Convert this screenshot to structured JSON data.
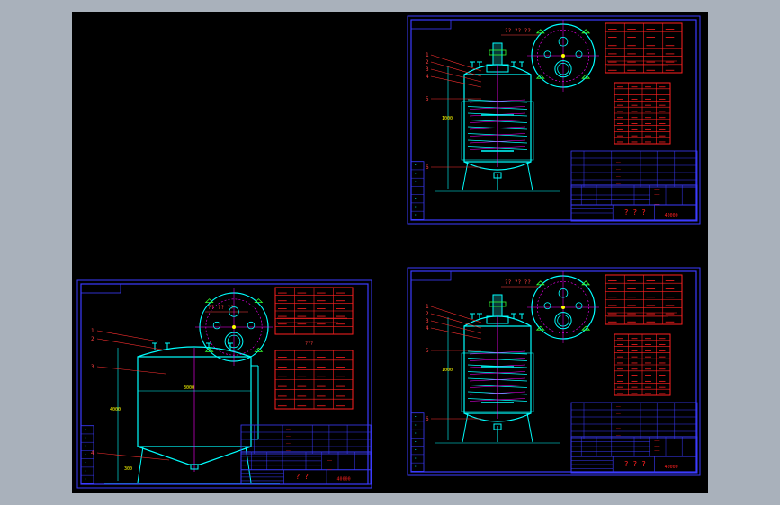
{
  "app": {
    "background_color": "#a9b1bb",
    "canvas_color": "#000000"
  },
  "colors": {
    "frame": "#3b3bff",
    "vessel": "#00ffff",
    "leader": "#ff3030",
    "table": "#ff2020",
    "callout": "#ff4040",
    "hatch": "#ff00ff",
    "green": "#33ff33",
    "yellow": "#ffff00"
  },
  "drawings": [
    {
      "id": "top-right",
      "type": "agitated-reactor",
      "section_title": "?? ?? ??",
      "title_block_name": "? ? ?",
      "drawing_number": "40000",
      "callouts": [
        "1",
        "2",
        "3",
        "4",
        "5",
        "6"
      ]
    },
    {
      "id": "bottom-left",
      "type": "storage-tank",
      "section_title": "?? ?? ??",
      "title_block_name": "? ?",
      "drawing_number": "40000",
      "callouts": [
        "1",
        "2",
        "3",
        "4"
      ]
    },
    {
      "id": "bottom-right",
      "type": "agitated-reactor",
      "section_title": "?? ?? ??",
      "title_block_name": "? ? ?",
      "drawing_number": "40000",
      "callouts": [
        "1",
        "2",
        "3",
        "4",
        "5",
        "6"
      ]
    }
  ]
}
